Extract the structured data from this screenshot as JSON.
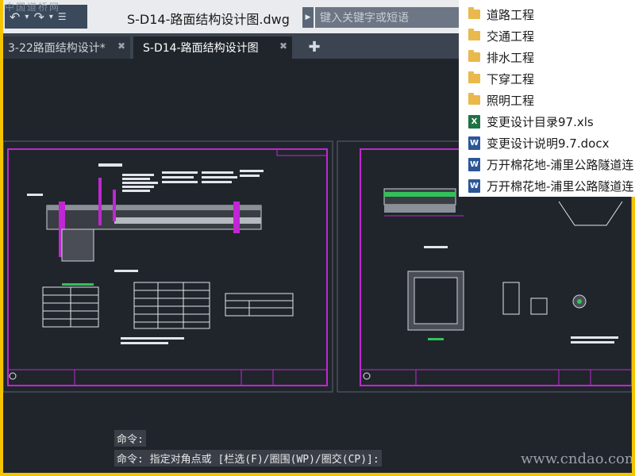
{
  "window": {
    "document_title": "S-D14-路面结构设计图.dwg",
    "watermark_top": "中国道桥网",
    "search_placeholder": "键入关键字或短语"
  },
  "quick_access": {
    "icons": [
      "undo-icon",
      "redo-icon",
      "dropdown-icon"
    ]
  },
  "tabs": [
    {
      "label": "3-22路面结构设计*",
      "active": false
    },
    {
      "label": "S-D14-路面结构设计图",
      "active": true
    }
  ],
  "command_line": [
    "命令:",
    "命令: 指定对角点或 [栏选(F)/圈围(WP)/圈交(CP)]:"
  ],
  "site_watermark": "www.cndao.com",
  "file_list": [
    {
      "name": "道路工程",
      "type": "folder"
    },
    {
      "name": "交通工程",
      "type": "folder"
    },
    {
      "name": "排水工程",
      "type": "folder"
    },
    {
      "name": "下穿工程",
      "type": "folder"
    },
    {
      "name": "照明工程",
      "type": "folder"
    },
    {
      "name": "变更设计目录97.xls",
      "type": "xls"
    },
    {
      "name": "变更设计说明9.7.docx",
      "type": "docx"
    },
    {
      "name": "万开棉花地-浦里公路隧道连",
      "type": "docx"
    },
    {
      "name": "万开棉花地-浦里公路隧道连",
      "type": "docx"
    }
  ],
  "colors": {
    "frame_border": "#f5c400",
    "sheet_border": "#c026d3",
    "canvas": "#20252c"
  }
}
